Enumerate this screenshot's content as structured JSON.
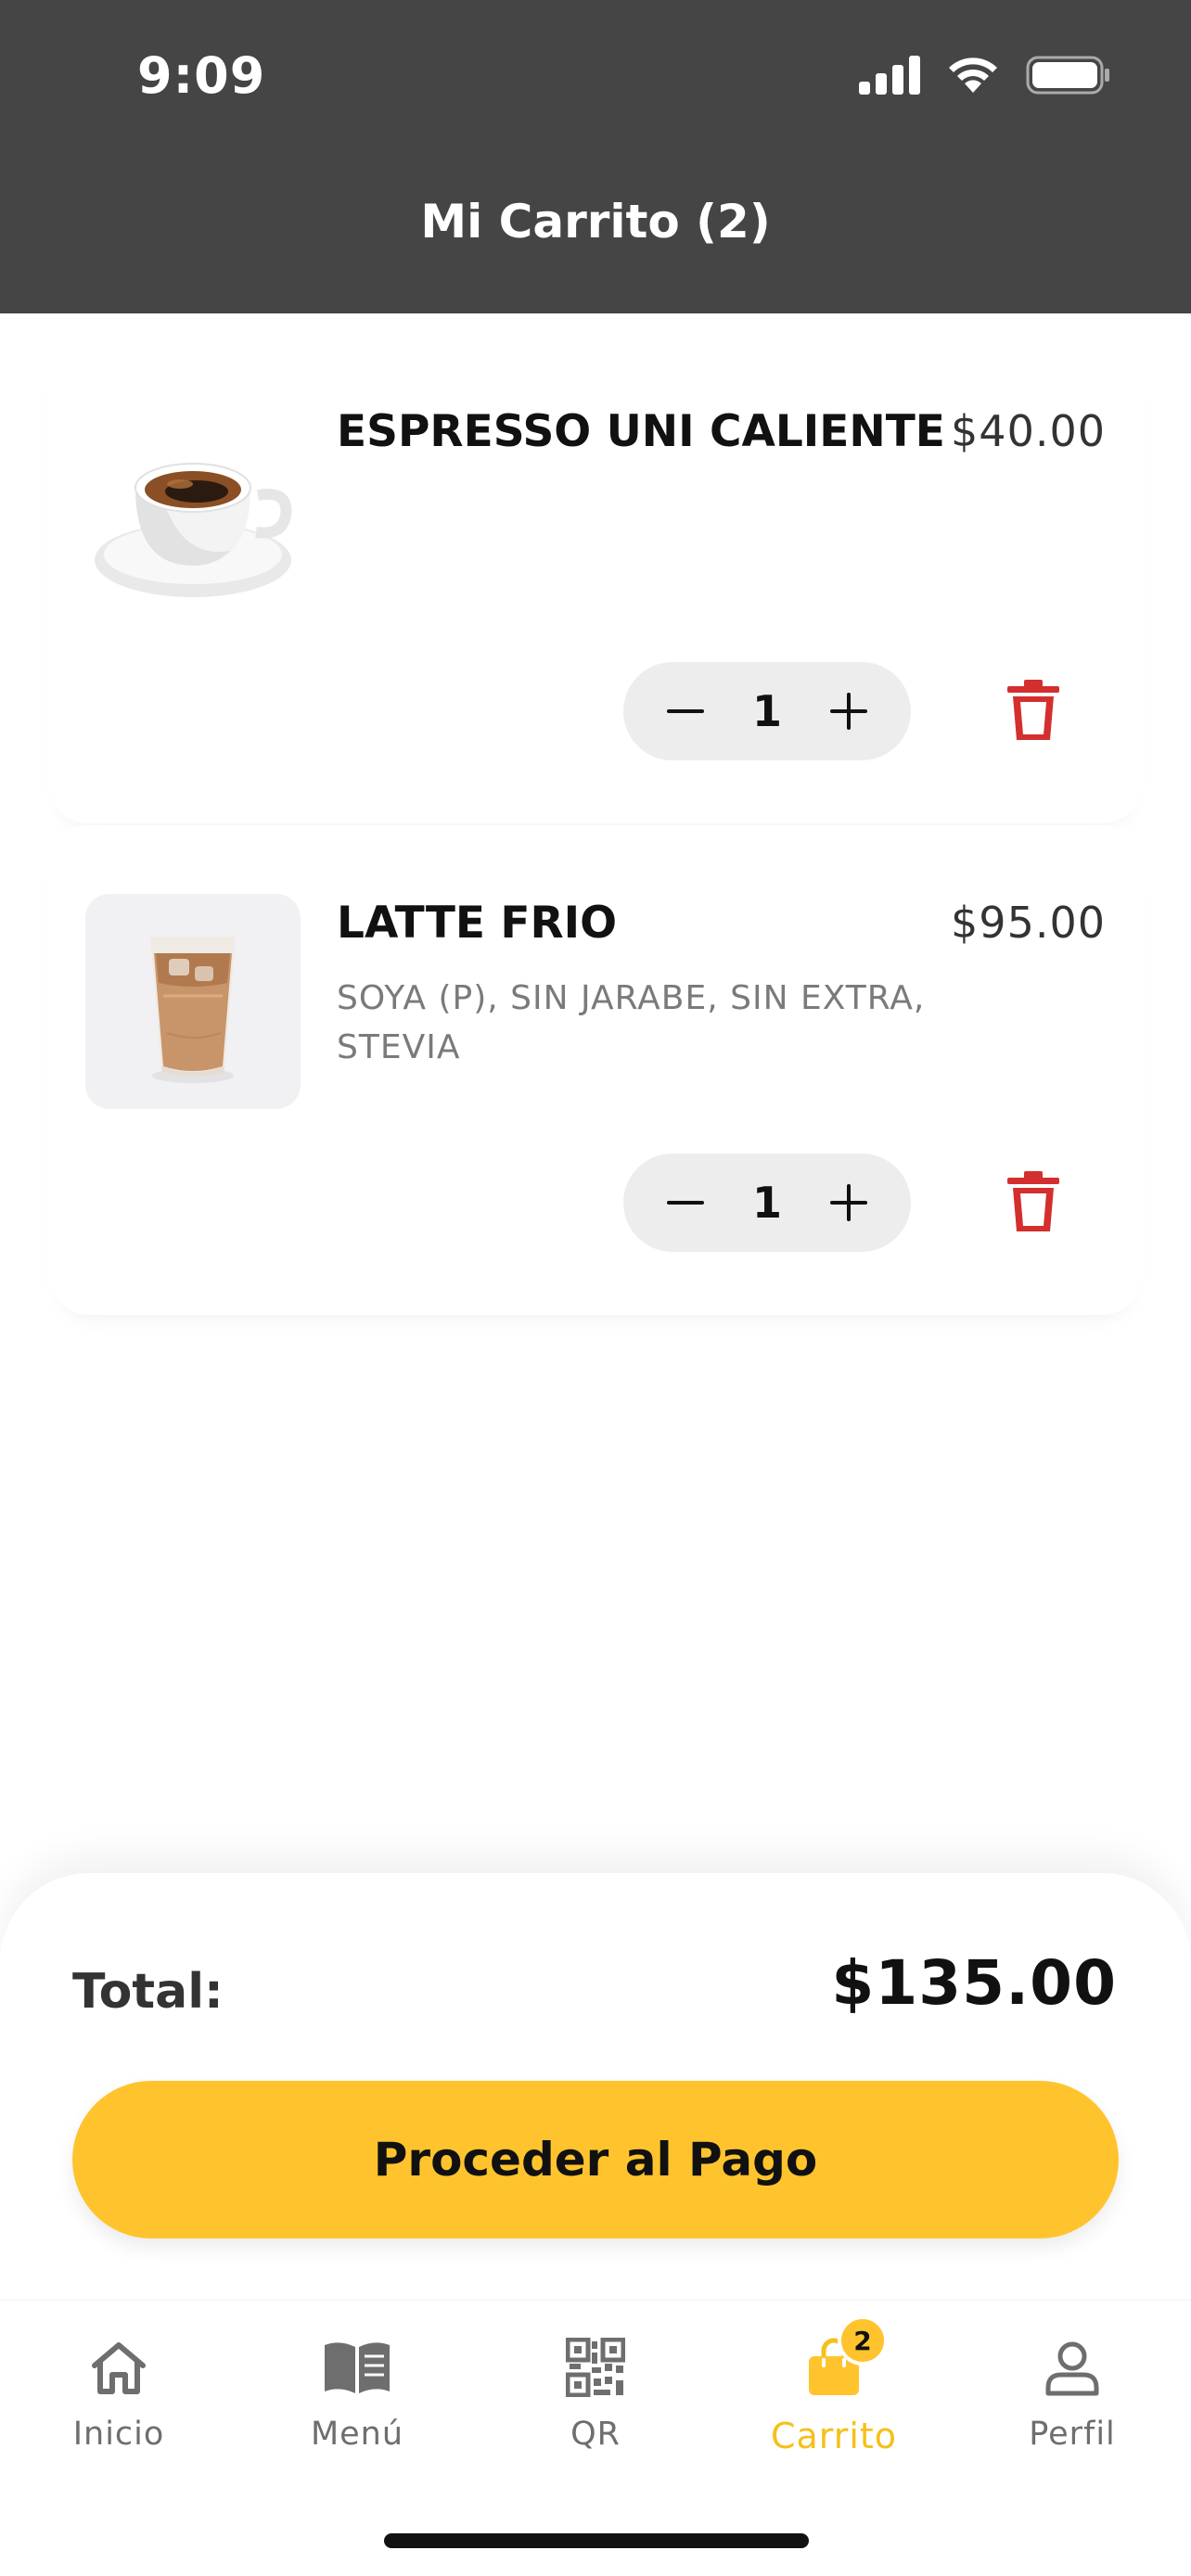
{
  "status_bar": {
    "time": "9:09"
  },
  "header": {
    "title": "Mi Carrito (2)"
  },
  "cart": {
    "items": [
      {
        "name": "ESPRESSO UNI CALIENTE",
        "price": "$40.00",
        "options": "",
        "quantity": "1"
      },
      {
        "name": "LATTE FRIO",
        "price": "$95.00",
        "options": "SOYA (P), SIN JARABE, SIN EXTRA, STEVIA",
        "quantity": "1"
      }
    ]
  },
  "summary": {
    "total_label": "Total:",
    "total_value": "$135.00",
    "pay_label": "Proceder al Pago"
  },
  "nav": {
    "items": [
      {
        "label": "Inicio",
        "icon": "home-icon"
      },
      {
        "label": "Menú",
        "icon": "book-icon"
      },
      {
        "label": "QR",
        "icon": "qr-code-icon"
      },
      {
        "label": "Carrito",
        "icon": "shopping-bag-icon",
        "badge": "2",
        "active": true
      },
      {
        "label": "Perfil",
        "icon": "user-icon"
      }
    ]
  },
  "colors": {
    "header_bg": "#454545",
    "accent": "#ffc42d",
    "active_nav": "#f5c019",
    "delete": "#d32f2f"
  }
}
